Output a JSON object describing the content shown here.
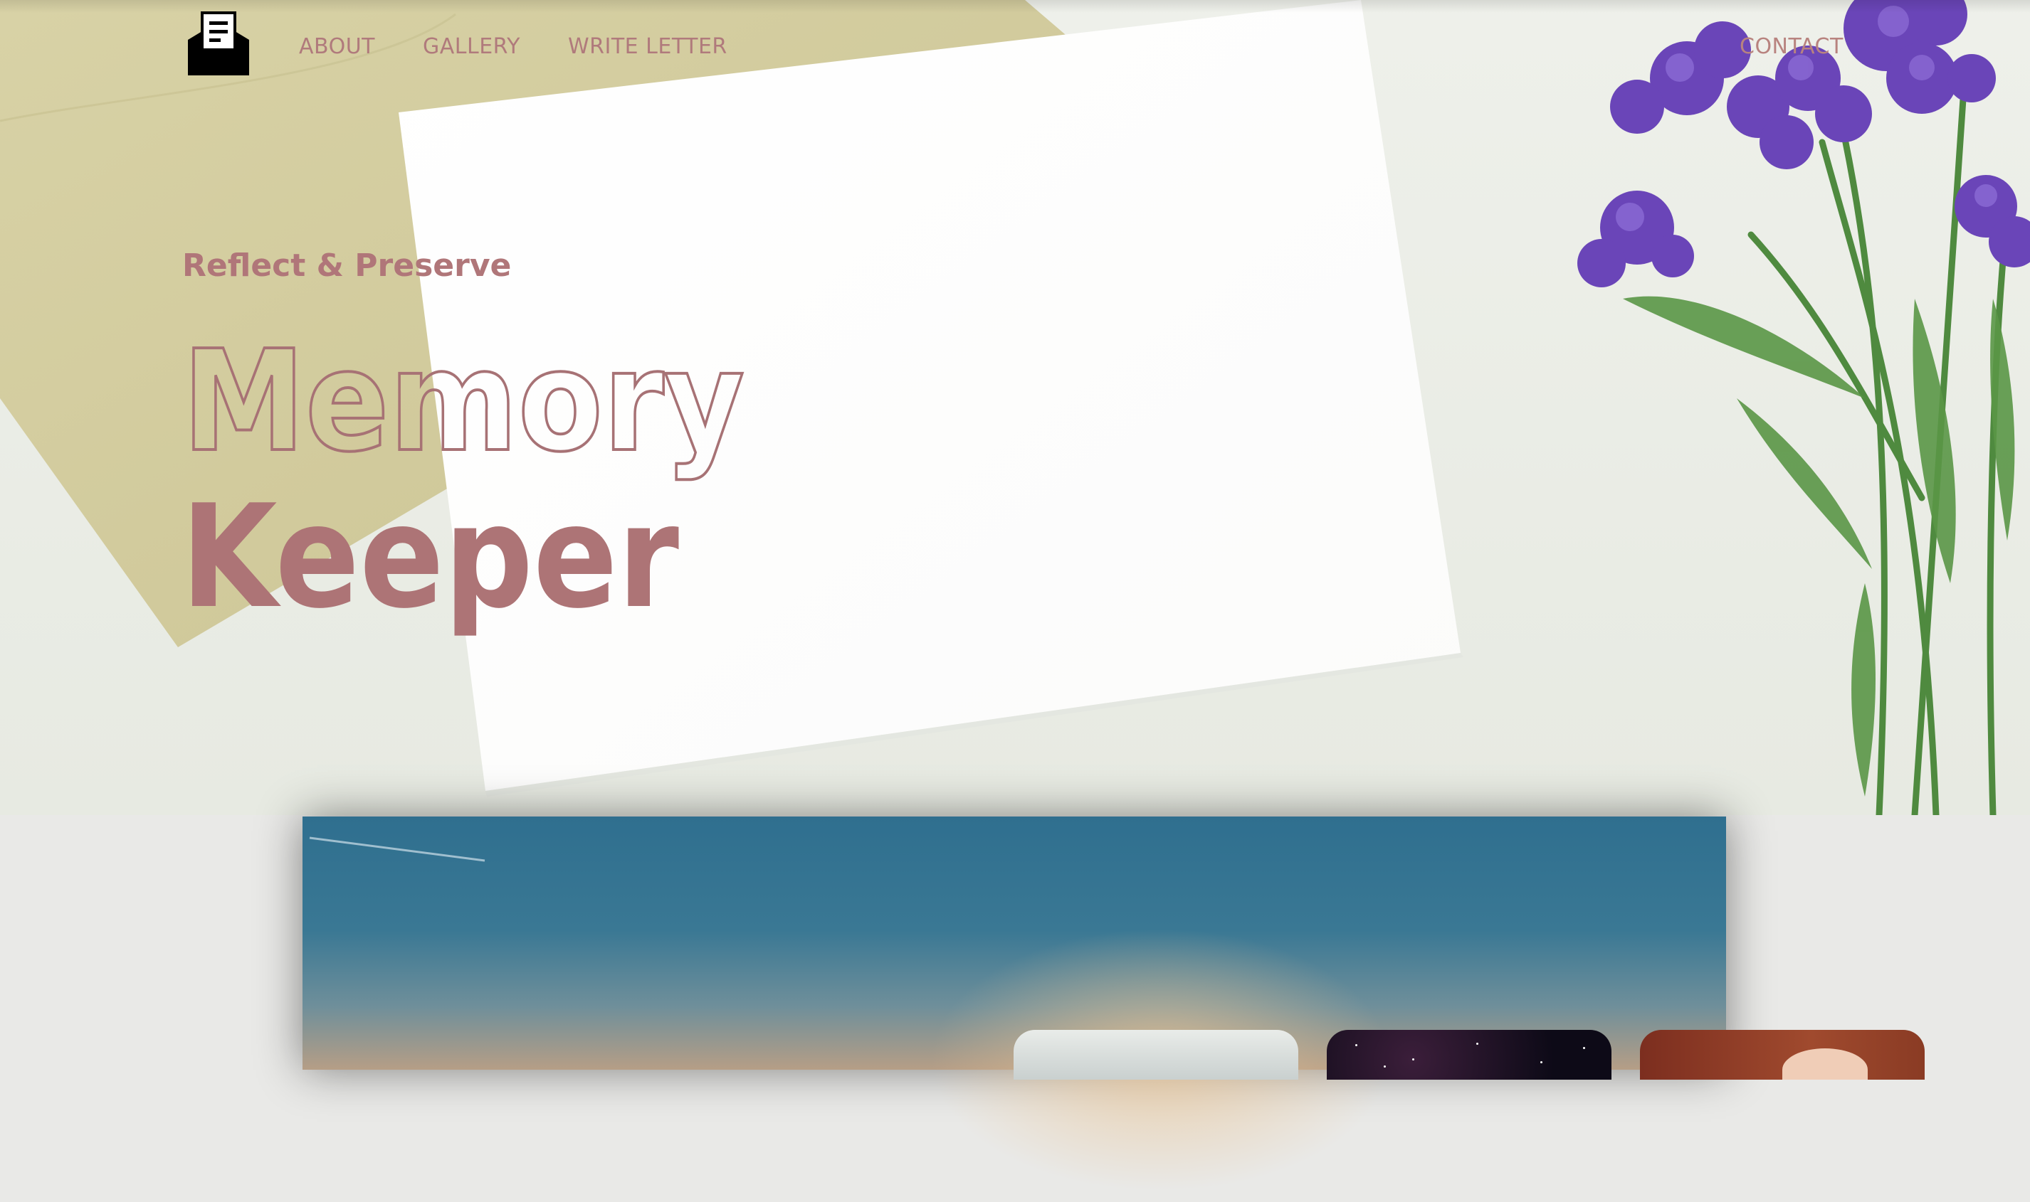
{
  "brand": {
    "logo_icon": "envelope-letter-icon"
  },
  "nav": {
    "about": "ABOUT",
    "gallery": "GALLERY",
    "write_letter": "WRITE LETTER",
    "contact": "CONTACT"
  },
  "hero": {
    "kicker": "Reflect & Preserve",
    "title_outline": "Memory",
    "title_solid": "Keeper"
  },
  "colors": {
    "accent": "#b07679",
    "nav_text": "#b07a7c",
    "banner_sky": "#2f6f8f"
  },
  "gallery_cards": [
    {
      "name": "clouds-photo"
    },
    {
      "name": "starry-sky-photo"
    },
    {
      "name": "hand-photo"
    }
  ]
}
